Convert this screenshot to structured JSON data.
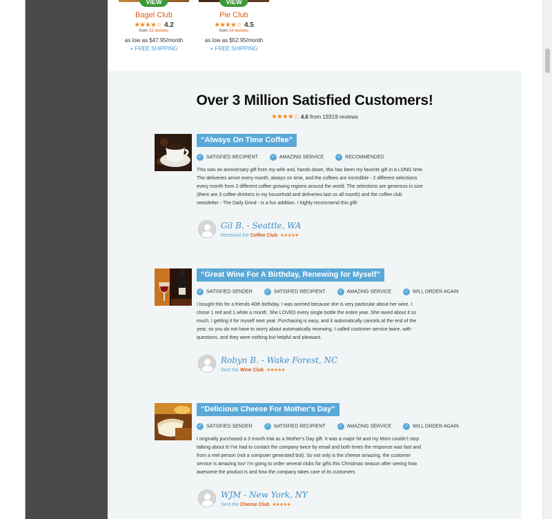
{
  "products": [
    {
      "name": "Bagel Club",
      "view_label": "VIEW",
      "rating": "4.2",
      "stars": "★★★★☆",
      "from_prefix": "from",
      "reviews_link": "33 reviews",
      "price": "as low as $47.95/month",
      "shipping": "+ FREE SHIPPING"
    },
    {
      "name": "Pie Club",
      "view_label": "VIEW",
      "rating": "4.5",
      "stars": "★★★★☆",
      "from_prefix": "from",
      "reviews_link": "24 reviews",
      "price": "as low as $52.95/month",
      "shipping": "+ FREE SHIPPING"
    }
  ],
  "reviews_section": {
    "title": "Over 3 Million Satisfied Customers!",
    "stars": "★★★★☆",
    "rating": "4.6",
    "summary_suffix": "from 19319 reviews"
  },
  "reviews": [
    {
      "headline": "“Always On Time Coffee”",
      "tags": [
        "SATISFIED RECIPIENT",
        "AMAZING SERVICE",
        "RECOMMENDED"
      ],
      "body": "This was an anniversary gift from my wife and, hands down, this has been my favorite gift in a LONG time. The deliveries arrive every month, always on time, and the coffees are incredible - 2 different selections every month from 2 different coffee growing regions around the world. The selections are generous in size (there are 3 coffee drinkers in my household and deliveries last us all month) and the coffee club newsletter - The Daily Grind - is a fun addition. I highly recommend this gift!",
      "reviewer": "Gil B. - Seattle, WA",
      "sub_prefix": "Received the",
      "club": "Coffee Club",
      "stars": "★★★★★",
      "photo": "coffee-photo"
    },
    {
      "headline": "“Great Wine For A Birthday, Renewing for Myself”",
      "tags": [
        "SATISFIED SENDER",
        "SATISFIED RECIPIENT",
        "AMAZING SERVICE",
        "WILL ORDER AGAIN"
      ],
      "body": "I bought this for a friends 40th birthday. I was worried because she is very particular about her wine. I chose 1 red and 1 white a month. She LOVED every single bottle the entire year. She raved about it so much, I getting it for myself next year. Purchasing is easy, and it automatically cancels at the end of the year, so you do not have to worry about automatically renewing. I called customer service twice, with questions, and they were nothing but helpful and pleasant.",
      "reviewer": "Robyn B. - Wake Forest, NC",
      "sub_prefix": "Sent the",
      "club": "Wine Club",
      "stars": "★★★★★",
      "photo": "wine-photo"
    },
    {
      "headline": "“Delicious Cheese For Mother's Day”",
      "tags": [
        "SATISFIED SENDER",
        "SATISFIED RECIPIENT",
        "AMAZING SERVICE",
        "WILL ORDER AGAIN"
      ],
      "body": "I originally purchased a 3 month trial as a Mother's Day gift. It was a major hit and my Mom couldn't stop talking about it! I've had to contact the company twice by email and both times the response was fast and from a reel person (not a computer generated bot). So not only is the cheese amazing, the customer service is amazing too! I'm going to order several clubs for gifts this Christmas season after seeing how awesome the product is and how the company takes care of its customers.",
      "reviewer": "WJM - New York, NY",
      "sub_prefix": "Sent the",
      "club": "Cheese Club",
      "stars": "★★★★★",
      "photo": "cheese-photo"
    }
  ],
  "colors": {
    "accent_blue": "#5aa8d8",
    "accent_orange": "#e05a12",
    "star": "#f28b1f",
    "view_green": "#3d9a3a",
    "panel_bg": "#f1f5f6"
  }
}
